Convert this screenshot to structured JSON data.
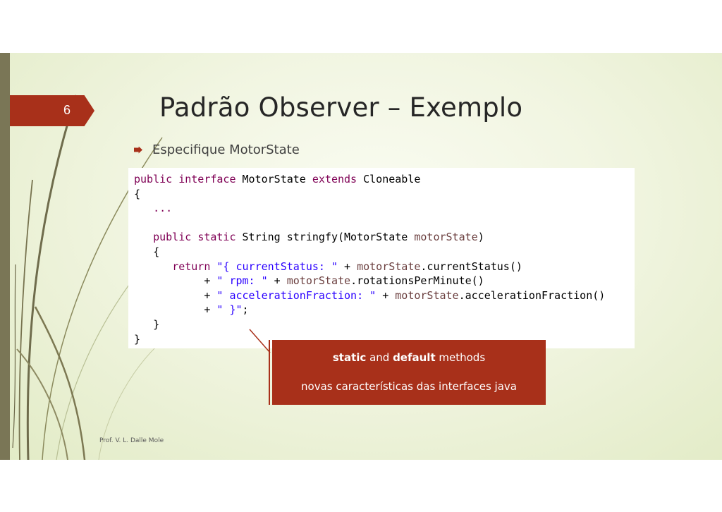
{
  "slide": {
    "number": "6",
    "title": "Padrão Observer – Exemplo",
    "bullet": "Especifique MotorState",
    "footer": "Prof. V. L. Dalle Mole"
  },
  "code": {
    "lines": [
      [
        {
          "t": "kw",
          "v": "public"
        },
        {
          "t": "plain",
          "v": " "
        },
        {
          "t": "kw",
          "v": "interface"
        },
        {
          "t": "plain",
          "v": " MotorState "
        },
        {
          "t": "kw",
          "v": "extends"
        },
        {
          "t": "plain",
          "v": " Cloneable"
        }
      ],
      [
        {
          "t": "plain",
          "v": "{"
        }
      ],
      [
        {
          "t": "plain",
          "v": "   "
        },
        {
          "t": "kw",
          "v": "..."
        }
      ],
      [
        {
          "t": "plain",
          "v": ""
        }
      ],
      [
        {
          "t": "plain",
          "v": "   "
        },
        {
          "t": "kw",
          "v": "public"
        },
        {
          "t": "plain",
          "v": " "
        },
        {
          "t": "kw",
          "v": "static"
        },
        {
          "t": "plain",
          "v": " String stringfy(MotorState "
        },
        {
          "t": "param",
          "v": "motorState"
        },
        {
          "t": "plain",
          "v": ")"
        }
      ],
      [
        {
          "t": "plain",
          "v": "   {"
        }
      ],
      [
        {
          "t": "plain",
          "v": "      "
        },
        {
          "t": "kw",
          "v": "return"
        },
        {
          "t": "plain",
          "v": " "
        },
        {
          "t": "str",
          "v": "\"{ currentStatus: \""
        },
        {
          "t": "plain",
          "v": " + "
        },
        {
          "t": "param",
          "v": "motorState"
        },
        {
          "t": "plain",
          "v": ".currentStatus()"
        }
      ],
      [
        {
          "t": "plain",
          "v": "           + "
        },
        {
          "t": "str",
          "v": "\" rpm: \""
        },
        {
          "t": "plain",
          "v": " + "
        },
        {
          "t": "param",
          "v": "motorState"
        },
        {
          "t": "plain",
          "v": ".rotationsPerMinute()"
        }
      ],
      [
        {
          "t": "plain",
          "v": "           + "
        },
        {
          "t": "str",
          "v": "\" accelerationFraction: \""
        },
        {
          "t": "plain",
          "v": " + "
        },
        {
          "t": "param",
          "v": "motorState"
        },
        {
          "t": "plain",
          "v": ".accelerationFraction()"
        }
      ],
      [
        {
          "t": "plain",
          "v": "           + "
        },
        {
          "t": "str",
          "v": "\" }\""
        },
        {
          "t": "plain",
          "v": ";"
        }
      ],
      [
        {
          "t": "plain",
          "v": "   }"
        }
      ],
      [
        {
          "t": "plain",
          "v": "}"
        }
      ]
    ]
  },
  "callout": {
    "line1_bold_a": "static",
    "line1_mid": " and ",
    "line1_bold_b": "default",
    "line1_tail": " methods",
    "line2": "novas características das interfaces java"
  },
  "colors": {
    "accent": "#a8301a",
    "keyword": "#7f0055",
    "string": "#2a00ff",
    "param": "#6a3e3e"
  }
}
